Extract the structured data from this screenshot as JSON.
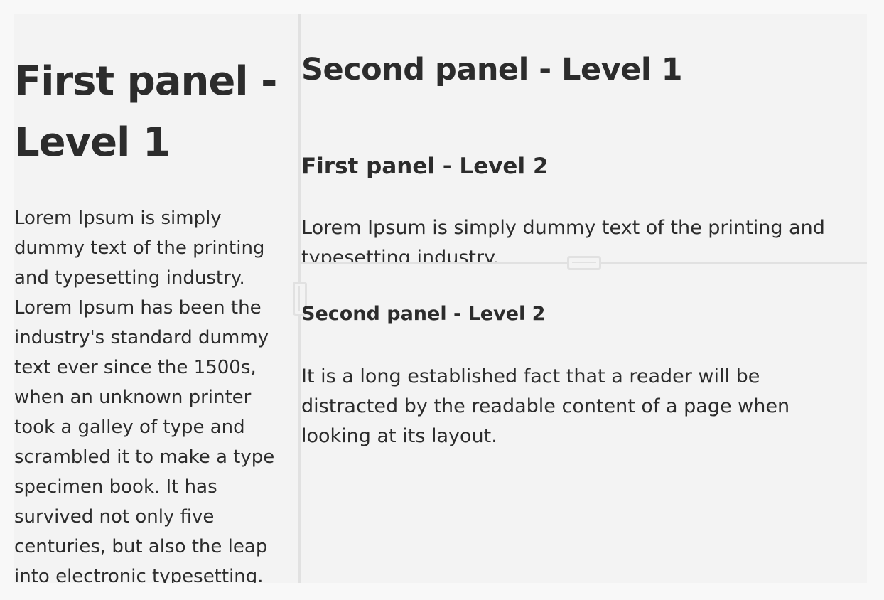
{
  "first_panel": {
    "heading": "First panel - Level 1",
    "body": "Lorem Ipsum is simply dummy text of the printing and typesetting industry. Lorem Ipsum has been the industry's standard dummy text ever since the 1500s, when an unknown printer took a galley of type and scrambled it to make a type specimen book. It has survived not only five centuries, but also the leap into electronic typesetting."
  },
  "second_panel": {
    "heading": "Second panel - Level 1",
    "first_sub": {
      "heading": "First panel - Level 2",
      "body": "Lorem Ipsum is simply dummy text of the printing and typesetting industry."
    },
    "second_sub": {
      "heading": "Second panel - Level 2",
      "body": "It is a long established fact that a reader will be distracted by the readable content of a page when looking at its layout."
    }
  },
  "colors": {
    "panel_bg": "#f3f3f3",
    "page_bg": "#f8f8f8",
    "divider": "#e1e1e1",
    "text": "#2c2c2c"
  }
}
